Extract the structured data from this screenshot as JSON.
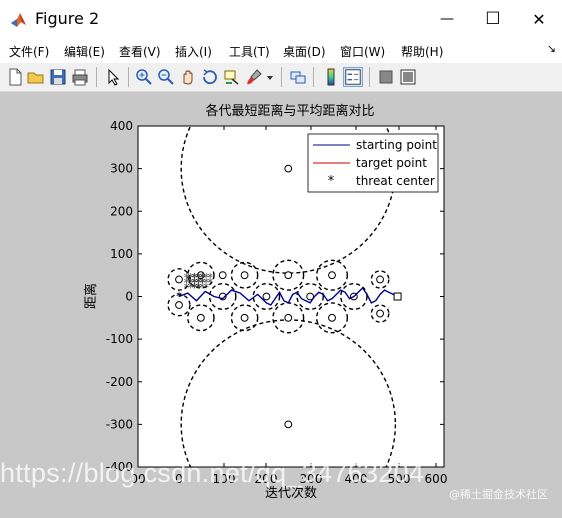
{
  "window": {
    "title": "Figure 2",
    "minimize_glyph": "—",
    "maximize_glyph": "☐",
    "close_glyph": "✕"
  },
  "menu": {
    "items": [
      {
        "label": "文件(F)"
      },
      {
        "label": "编辑(E)"
      },
      {
        "label": "查看(V)"
      },
      {
        "label": "插入(I)"
      },
      {
        "label": "工具(T)"
      },
      {
        "label": "桌面(D)"
      },
      {
        "label": "窗口(W)"
      },
      {
        "label": "帮助(H)"
      }
    ],
    "overflow_glyph": "↘"
  },
  "toolbar": {
    "icons": [
      "new-file-icon",
      "open-folder-icon",
      "save-icon",
      "print-icon",
      "pointer-icon",
      "zoom-in-icon",
      "zoom-out-icon",
      "pan-hand-icon",
      "rotate-3d-icon",
      "data-cursor-icon",
      "brush-icon",
      "link-plot-icon",
      "colorbar-icon",
      "legend-icon",
      "hide-plot-tools-icon",
      "show-plot-tools-icon"
    ]
  },
  "chart_data": {
    "type": "line",
    "title": "各代最短距离与平均距离对比",
    "xlabel": "迭代次数",
    "ylabel": "距离",
    "xlim": [
      0,
      700
    ],
    "ylim": [
      -400,
      400
    ],
    "xticks": [
      100,
      200,
      300,
      400,
      500,
      600
    ],
    "xtick_labels": [
      "00",
      "0",
      "100",
      "200",
      "300",
      "400",
      "500",
      "600"
    ],
    "yticks": [
      400,
      300,
      200,
      100,
      0,
      -100,
      -200,
      -300,
      -400
    ],
    "grid": false,
    "legend": {
      "placement": "top-right",
      "entries": [
        {
          "label": "starting point",
          "color": "#00008b",
          "style": "line"
        },
        {
          "label": "target point",
          "color": "#cc0000",
          "style": "line"
        },
        {
          "label": "threat center",
          "color": "#000000",
          "style": "asterisk"
        }
      ]
    },
    "start_point": [
      0,
      0
    ],
    "target_point": [
      500,
      0
    ],
    "threat_centers": [
      [
        0,
        40
      ],
      [
        0,
        -20
      ],
      [
        50,
        50
      ],
      [
        50,
        -50
      ],
      [
        100,
        0
      ],
      [
        100,
        50
      ],
      [
        150,
        50
      ],
      [
        150,
        -50
      ],
      [
        200,
        0
      ],
      [
        250,
        50
      ],
      [
        250,
        -50
      ],
      [
        300,
        0
      ],
      [
        350,
        50
      ],
      [
        350,
        -50
      ],
      [
        400,
        0
      ],
      [
        460,
        40
      ],
      [
        460,
        -40
      ],
      [
        250,
        300
      ],
      [
        250,
        -300
      ]
    ],
    "threat_circles": [
      {
        "center": [
          0,
          40
        ],
        "r": 25
      },
      {
        "center": [
          0,
          -20
        ],
        "r": 25
      },
      {
        "center": [
          50,
          50
        ],
        "r": 30
      },
      {
        "center": [
          50,
          -50
        ],
        "r": 30
      },
      {
        "center": [
          100,
          0
        ],
        "r": 30
      },
      {
        "center": [
          150,
          50
        ],
        "r": 30
      },
      {
        "center": [
          150,
          -50
        ],
        "r": 30
      },
      {
        "center": [
          200,
          0
        ],
        "r": 30
      },
      {
        "center": [
          250,
          50
        ],
        "r": 35
      },
      {
        "center": [
          250,
          -50
        ],
        "r": 35
      },
      {
        "center": [
          300,
          0
        ],
        "r": 30
      },
      {
        "center": [
          350,
          50
        ],
        "r": 35
      },
      {
        "center": [
          350,
          -50
        ],
        "r": 35
      },
      {
        "center": [
          400,
          0
        ],
        "r": 30
      },
      {
        "center": [
          460,
          40
        ],
        "r": 20
      },
      {
        "center": [
          460,
          -40
        ],
        "r": 20
      },
      {
        "center": [
          250,
          300
        ],
        "r": 245
      },
      {
        "center": [
          250,
          -300
        ],
        "r": 245
      }
    ],
    "path": {
      "x": [
        0,
        20,
        40,
        60,
        80,
        100,
        120,
        140,
        160,
        180,
        200,
        210,
        220,
        230,
        240,
        250,
        260,
        270,
        280,
        290,
        300,
        310,
        320,
        330,
        340,
        350,
        360,
        370,
        380,
        390,
        400,
        410,
        420,
        430,
        440,
        450,
        460,
        470,
        480,
        490,
        500
      ],
      "y": [
        0,
        8,
        -10,
        12,
        0,
        -5,
        15,
        8,
        -10,
        5,
        -15,
        -20,
        -5,
        10,
        -10,
        -15,
        5,
        10,
        -5,
        -10,
        -15,
        0,
        10,
        5,
        -10,
        -5,
        5,
        15,
        10,
        -5,
        0,
        10,
        20,
        5,
        -15,
        -10,
        5,
        15,
        10,
        5,
        0
      ]
    },
    "overlapping_text_cluster_center": [
      50,
      40
    ]
  },
  "watermark": {
    "url_text": "https://blog.csdn.net/qq_34763204",
    "credit_text": "@稀土掘金技术社区"
  },
  "colors": {
    "figure_bg": "#c8c8c8",
    "axes_bg": "#ffffff",
    "path_color": "#00008b",
    "target_color": "#cc0000"
  }
}
